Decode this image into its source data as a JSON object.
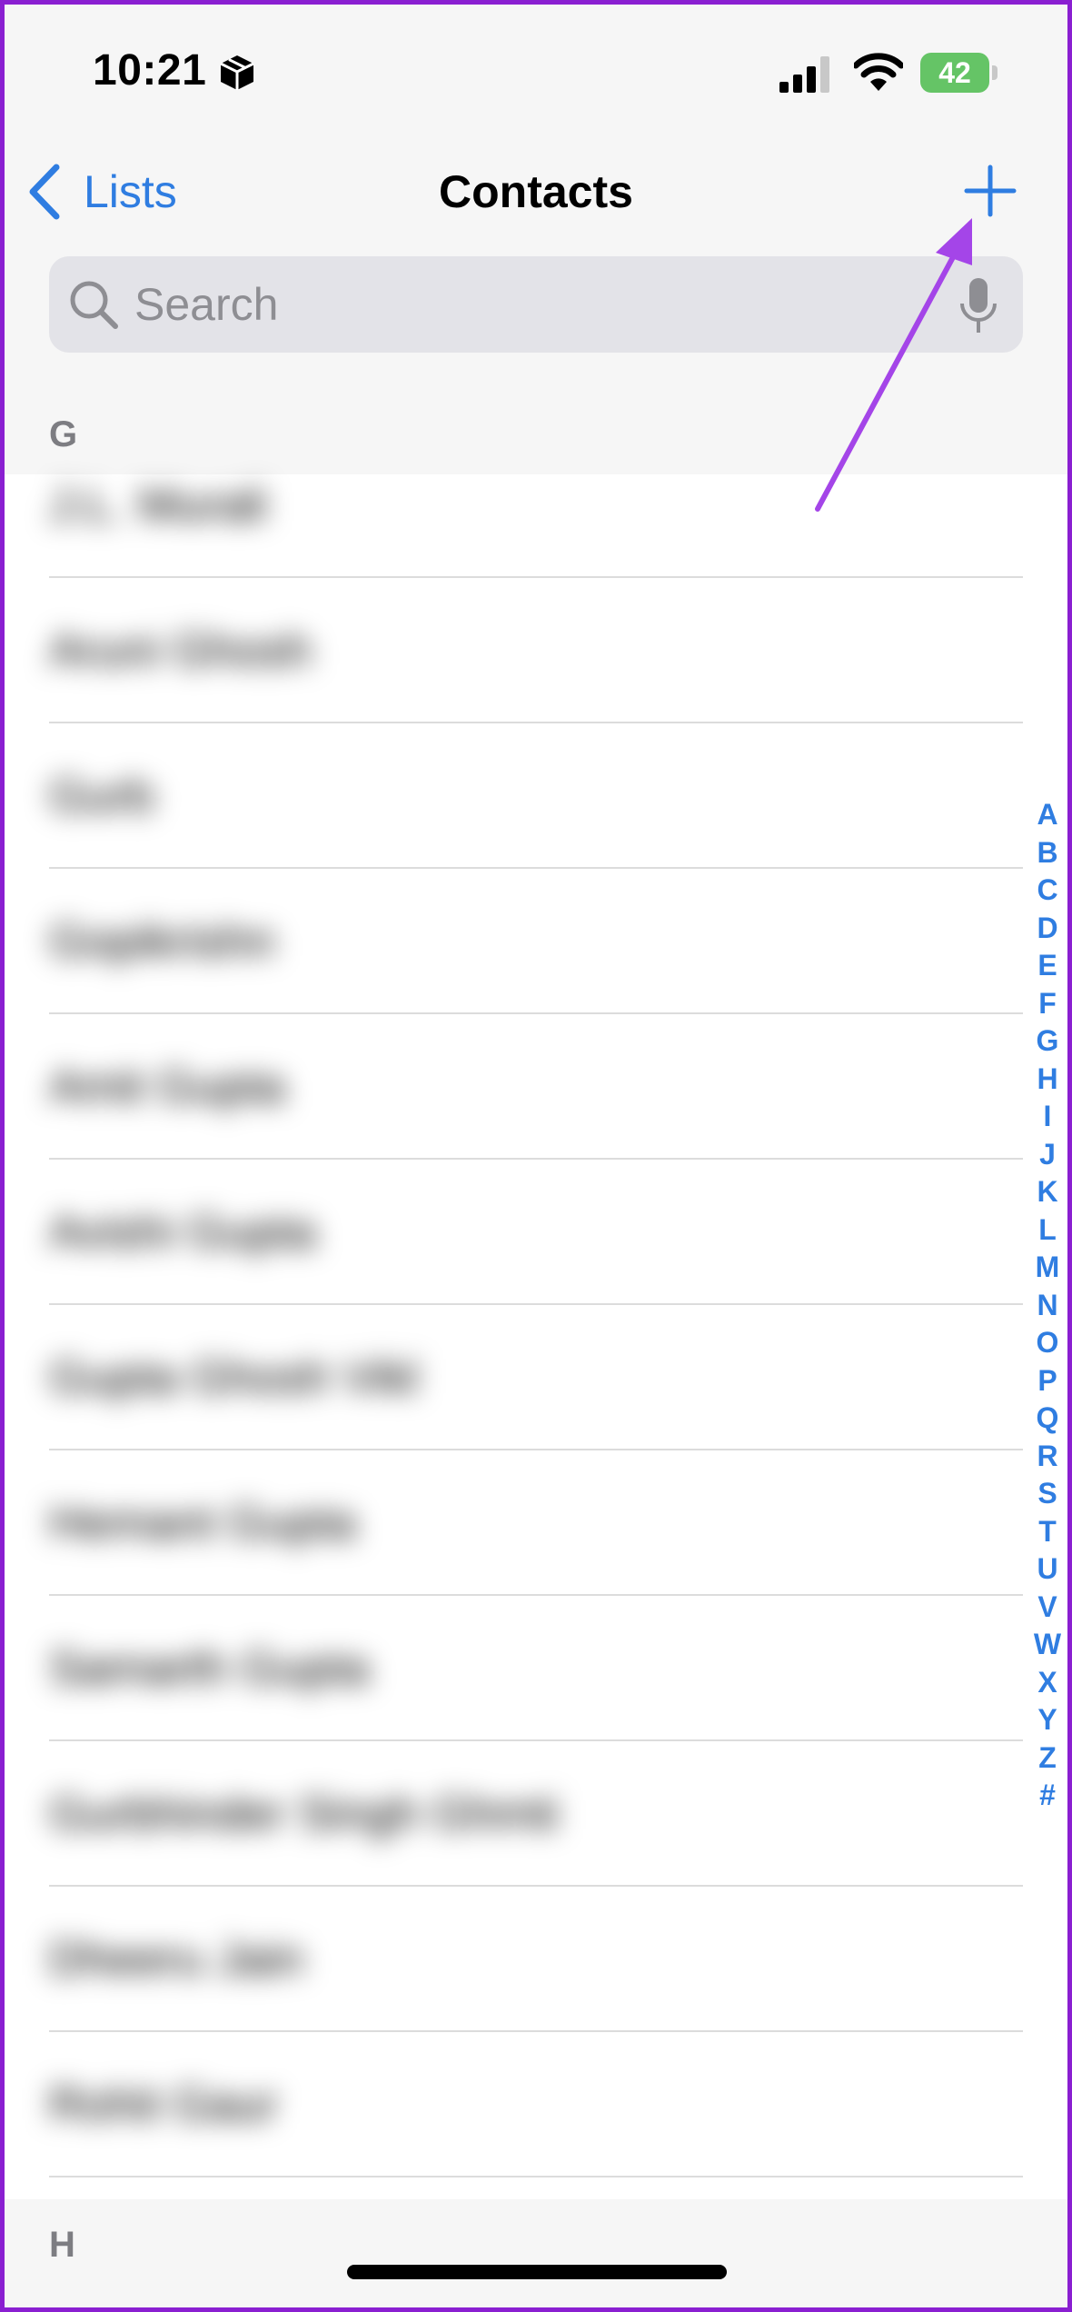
{
  "status_bar": {
    "time": "10:21",
    "battery_level": "42",
    "icons": [
      "box-icon",
      "signal-icon",
      "wifi-icon",
      "battery-icon"
    ]
  },
  "nav": {
    "back_label": "Lists",
    "title": "Contacts",
    "add_icon": "plus-icon"
  },
  "search": {
    "placeholder": "Search"
  },
  "sections": [
    {
      "label": "G"
    },
    {
      "label": "H"
    }
  ],
  "contacts": [
    {
      "name": "J.L. Murali"
    },
    {
      "name": "Aruni Ghosh"
    },
    {
      "name": "Gurb"
    },
    {
      "name": "Gopikrishn"
    },
    {
      "name": "Amit Gupta"
    },
    {
      "name": "Avishi Gupta"
    },
    {
      "name": "Gupta Ghosh Vikl"
    },
    {
      "name": "Hemant Gupta"
    },
    {
      "name": "Samarth Gupta"
    },
    {
      "name": "Gurbhinder Singh Ghmti"
    },
    {
      "name": "Dheeru Jain"
    },
    {
      "name": "Rohit Gaur"
    }
  ],
  "index_letters": [
    "A",
    "B",
    "C",
    "D",
    "E",
    "F",
    "G",
    "H",
    "I",
    "J",
    "K",
    "L",
    "M",
    "N",
    "O",
    "P",
    "Q",
    "R",
    "S",
    "T",
    "U",
    "V",
    "W",
    "X",
    "Y",
    "Z",
    "#"
  ],
  "colors": {
    "accent": "#2f7de1",
    "annotation_arrow": "#a445e8",
    "battery": "#65c466",
    "frame": "#8a1fd1"
  }
}
